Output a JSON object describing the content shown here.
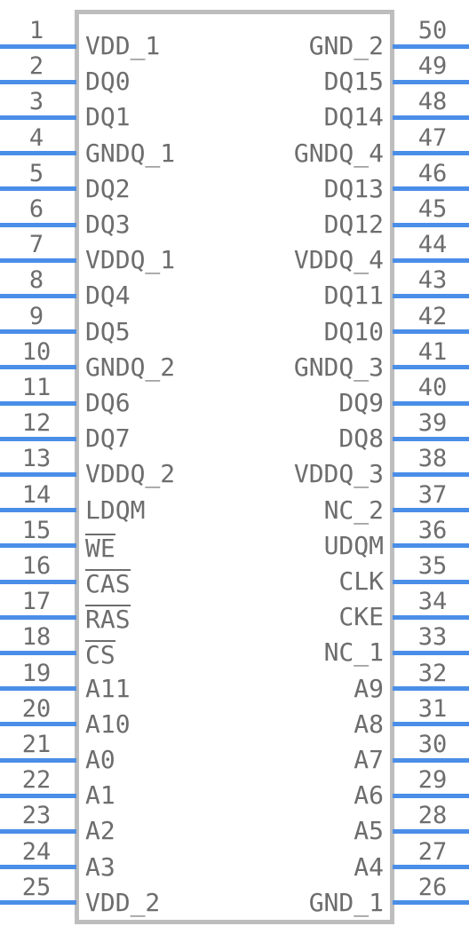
{
  "symbol": {
    "type": "ic-pin-diagram",
    "package": "50-pin",
    "pin_count": 50,
    "colors": {
      "wire": "#4a8ee8",
      "body_border": "#bdbdbd",
      "text": "#6d6d6d",
      "background": "#ffffff"
    }
  },
  "left_pins": [
    {
      "number": "1",
      "label": "VDD_1",
      "overline": false
    },
    {
      "number": "2",
      "label": "DQ0",
      "overline": false
    },
    {
      "number": "3",
      "label": "DQ1",
      "overline": false
    },
    {
      "number": "4",
      "label": "GNDQ_1",
      "overline": false
    },
    {
      "number": "5",
      "label": "DQ2",
      "overline": false
    },
    {
      "number": "6",
      "label": "DQ3",
      "overline": false
    },
    {
      "number": "7",
      "label": "VDDQ_1",
      "overline": false
    },
    {
      "number": "8",
      "label": "DQ4",
      "overline": false
    },
    {
      "number": "9",
      "label": "DQ5",
      "overline": false
    },
    {
      "number": "10",
      "label": "GNDQ_2",
      "overline": false
    },
    {
      "number": "11",
      "label": "DQ6",
      "overline": false
    },
    {
      "number": "12",
      "label": "DQ7",
      "overline": false
    },
    {
      "number": "13",
      "label": "VDDQ_2",
      "overline": false
    },
    {
      "number": "14",
      "label": "LDQM",
      "overline": false
    },
    {
      "number": "15",
      "label": "WE",
      "overline": true
    },
    {
      "number": "16",
      "label": "CAS",
      "overline": true
    },
    {
      "number": "17",
      "label": "RAS",
      "overline": true
    },
    {
      "number": "18",
      "label": "CS",
      "overline": true
    },
    {
      "number": "19",
      "label": "A11",
      "overline": false
    },
    {
      "number": "20",
      "label": "A10",
      "overline": false
    },
    {
      "number": "21",
      "label": "A0",
      "overline": false
    },
    {
      "number": "22",
      "label": "A1",
      "overline": false
    },
    {
      "number": "23",
      "label": "A2",
      "overline": false
    },
    {
      "number": "24",
      "label": "A3",
      "overline": false
    },
    {
      "number": "25",
      "label": "VDD_2",
      "overline": false
    }
  ],
  "right_pins": [
    {
      "number": "50",
      "label": "GND_2",
      "overline": false
    },
    {
      "number": "49",
      "label": "DQ15",
      "overline": false
    },
    {
      "number": "48",
      "label": "DQ14",
      "overline": false
    },
    {
      "number": "47",
      "label": "GNDQ_4",
      "overline": false
    },
    {
      "number": "46",
      "label": "DQ13",
      "overline": false
    },
    {
      "number": "45",
      "label": "DQ12",
      "overline": false
    },
    {
      "number": "44",
      "label": "VDDQ_4",
      "overline": false
    },
    {
      "number": "43",
      "label": "DQ11",
      "overline": false
    },
    {
      "number": "42",
      "label": "DQ10",
      "overline": false
    },
    {
      "number": "41",
      "label": "GNDQ_3",
      "overline": false
    },
    {
      "number": "40",
      "label": "DQ9",
      "overline": false
    },
    {
      "number": "39",
      "label": "DQ8",
      "overline": false
    },
    {
      "number": "38",
      "label": "VDDQ_3",
      "overline": false
    },
    {
      "number": "37",
      "label": "NC_2",
      "overline": false
    },
    {
      "number": "36",
      "label": "UDQM",
      "overline": false
    },
    {
      "number": "35",
      "label": "CLK",
      "overline": false
    },
    {
      "number": "34",
      "label": "CKE",
      "overline": false
    },
    {
      "number": "33",
      "label": "NC_1",
      "overline": false
    },
    {
      "number": "32",
      "label": "A9",
      "overline": false
    },
    {
      "number": "31",
      "label": "A8",
      "overline": false
    },
    {
      "number": "30",
      "label": "A7",
      "overline": false
    },
    {
      "number": "29",
      "label": "A6",
      "overline": false
    },
    {
      "number": "28",
      "label": "A5",
      "overline": false
    },
    {
      "number": "27",
      "label": "A4",
      "overline": false
    },
    {
      "number": "26",
      "label": "GND_1",
      "overline": false
    }
  ]
}
